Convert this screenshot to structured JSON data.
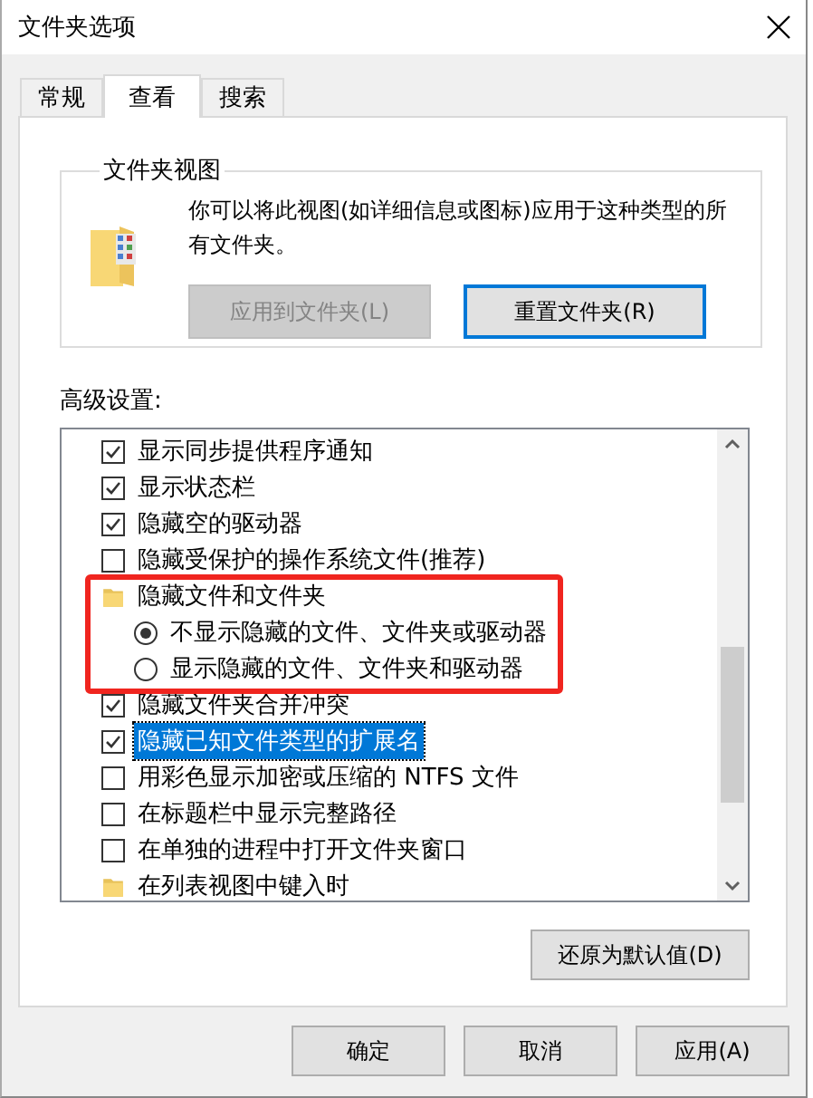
{
  "window": {
    "title": "文件夹选项"
  },
  "tabs": [
    {
      "label": "常规",
      "selected": false
    },
    {
      "label": "查看",
      "selected": true
    },
    {
      "label": "搜索",
      "selected": false
    }
  ],
  "folder_views": {
    "title": "文件夹视图",
    "description": "你可以将此视图(如详细信息或图标)应用于这种类型的所有文件夹。",
    "buttons": [
      {
        "label": "应用到文件夹(L)",
        "disabled": true,
        "focused": false
      },
      {
        "label": "重置文件夹(R)",
        "disabled": false,
        "focused": true
      }
    ]
  },
  "advanced": {
    "label": "高级设置:",
    "items": [
      {
        "kind": "checkbox",
        "label": "显示同步提供程序通知",
        "checked": true,
        "selected": false
      },
      {
        "kind": "checkbox",
        "label": "显示状态栏",
        "checked": true,
        "selected": false
      },
      {
        "kind": "checkbox",
        "label": "隐藏空的驱动器",
        "checked": true,
        "selected": false
      },
      {
        "kind": "checkbox",
        "label": "隐藏受保护的操作系统文件(推荐)",
        "checked": false,
        "selected": false
      },
      {
        "kind": "group",
        "label": "隐藏文件和文件夹",
        "selected": false,
        "highlighted": true,
        "children": [
          {
            "kind": "radio",
            "label": "不显示隐藏的文件、文件夹或驱动器",
            "checked": true,
            "selected": false
          },
          {
            "kind": "radio",
            "label": "显示隐藏的文件、文件夹和驱动器",
            "checked": false,
            "selected": false
          }
        ]
      },
      {
        "kind": "checkbox",
        "label": "隐藏文件夹合并冲突",
        "checked": true,
        "selected": false
      },
      {
        "kind": "checkbox",
        "label": "隐藏已知文件类型的扩展名",
        "checked": true,
        "selected": true
      },
      {
        "kind": "checkbox",
        "label": "用彩色显示加密或压缩的 NTFS 文件",
        "checked": false,
        "selected": false
      },
      {
        "kind": "checkbox",
        "label": "在标题栏中显示完整路径",
        "checked": false,
        "selected": false
      },
      {
        "kind": "checkbox",
        "label": "在单独的进程中打开文件夹窗口",
        "checked": false,
        "selected": false
      },
      {
        "kind": "group",
        "label": "在列表视图中键入时",
        "selected": false,
        "highlighted": false
      }
    ]
  },
  "restore_button": {
    "label": "还原为默认值(D)"
  },
  "buttons": [
    {
      "label": "确定"
    },
    {
      "label": "取消"
    },
    {
      "label": "应用(A)"
    }
  ]
}
